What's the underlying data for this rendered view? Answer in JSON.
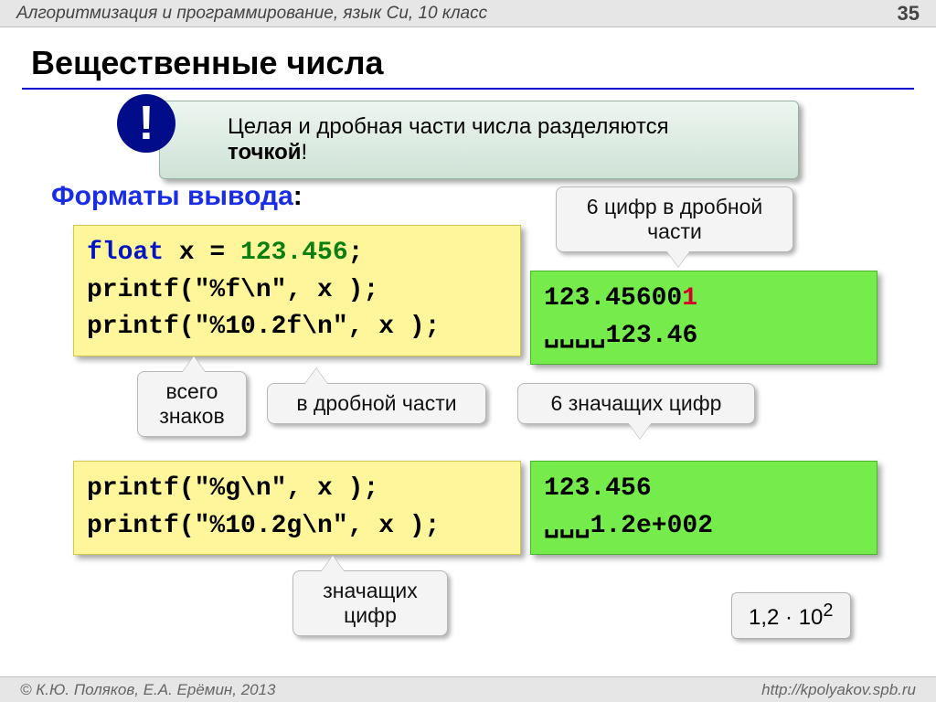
{
  "header": {
    "subject": "Алгоритмизация и программирование, язык Си, 10 класс",
    "page_number": "35"
  },
  "footer": {
    "authors": "© К.Ю. Поляков, Е.А. Ерёмин, 2013",
    "url": "http://kpolyakov.spb.ru"
  },
  "title": "Вещественные числа",
  "subhead": "Форматы вывода",
  "subhead_colon": ":",
  "callout": {
    "line1": "Целая и дробная части числа разделяются",
    "strong": "точкой",
    "exclaim": "!"
  },
  "code1": {
    "l1_kw": "float",
    "l1_var": " x = ",
    "l1_num": "123.456",
    "l1_tail": ";",
    "l2": "printf(\"%f\\n\", x );",
    "l3": "printf(\"%10.2f\\n\", x );"
  },
  "out1": {
    "l1_a": "123.45600",
    "l1_b": "1",
    "l2_spaces": "␣␣␣␣",
    "l2_val": "123.46"
  },
  "code2": {
    "l1": "printf(\"%g\\n\", x );",
    "l2": "printf(\"%10.2g\\n\", x );"
  },
  "out2": {
    "l1": "123.456",
    "l2_spaces": "␣␣␣",
    "l2_val": "1.2e+002"
  },
  "speech": {
    "six_frac_l1": "6 цифр в дробной",
    "six_frac_l2": "части",
    "total_l1": "всего",
    "total_l2": "знаков",
    "in_frac": "в дробной части",
    "six_sig": "6 значащих цифр",
    "sig_l1": "значащих",
    "sig_l2": "цифр"
  },
  "info_sci": {
    "a": "1,2 · 10",
    "sup": "2"
  }
}
